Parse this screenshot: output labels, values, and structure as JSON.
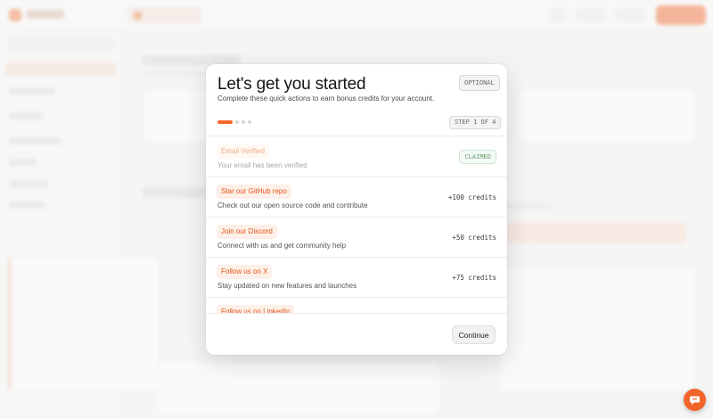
{
  "modal": {
    "title": "Let's get you started",
    "subtitle": "Complete these quick actions to earn bonus credits for your account.",
    "optional_badge": "OPTIONAL",
    "step_label": "STEP 1 OF 4",
    "progress": {
      "current_step": 1,
      "total_steps": 4
    },
    "tasks": [
      {
        "label": "Email Verified",
        "description": "Your email has been verified",
        "status": "CLAIMED"
      },
      {
        "label": "Star our GitHub repo",
        "description": "Check out our open source code and contribute",
        "reward": "+100 credits"
      },
      {
        "label": "Join our Discord",
        "description": "Connect with us and get community help",
        "reward": "+50 credits"
      },
      {
        "label": "Follow us on X",
        "description": "Stay updated on new features and launches",
        "reward": "+75 credits"
      },
      {
        "label": "Follow us on LinkedIn"
      }
    ],
    "continue_label": "Continue"
  },
  "colors": {
    "accent": "#f2652a",
    "claimed_green": "#6a9e74"
  },
  "icons": {
    "chat": "chat-icon"
  }
}
